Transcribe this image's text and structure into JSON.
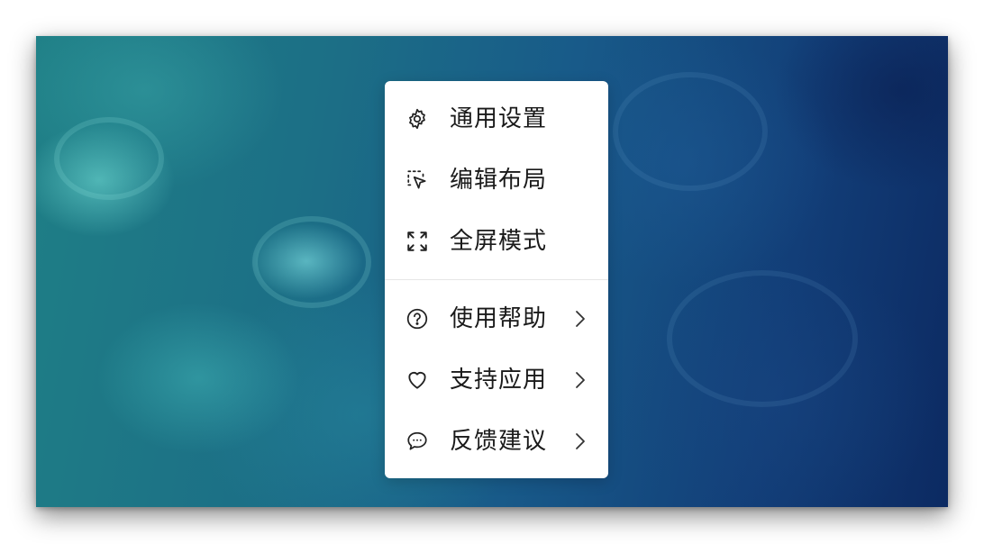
{
  "menu": {
    "items": [
      {
        "label": "通用设置",
        "icon": "gear-icon",
        "has_submenu": false
      },
      {
        "label": "编辑布局",
        "icon": "edit-layout-icon",
        "has_submenu": false
      },
      {
        "label": "全屏模式",
        "icon": "fullscreen-icon",
        "has_submenu": false
      },
      {
        "label": "使用帮助",
        "icon": "help-circle-icon",
        "has_submenu": true
      },
      {
        "label": "支持应用",
        "icon": "heart-icon",
        "has_submenu": true
      },
      {
        "label": "反馈建议",
        "icon": "chat-bubble-icon",
        "has_submenu": true
      }
    ]
  },
  "colors": {
    "menu_background": "#ffffff",
    "text": "#1a1a1a",
    "divider": "#e6e6e6"
  }
}
